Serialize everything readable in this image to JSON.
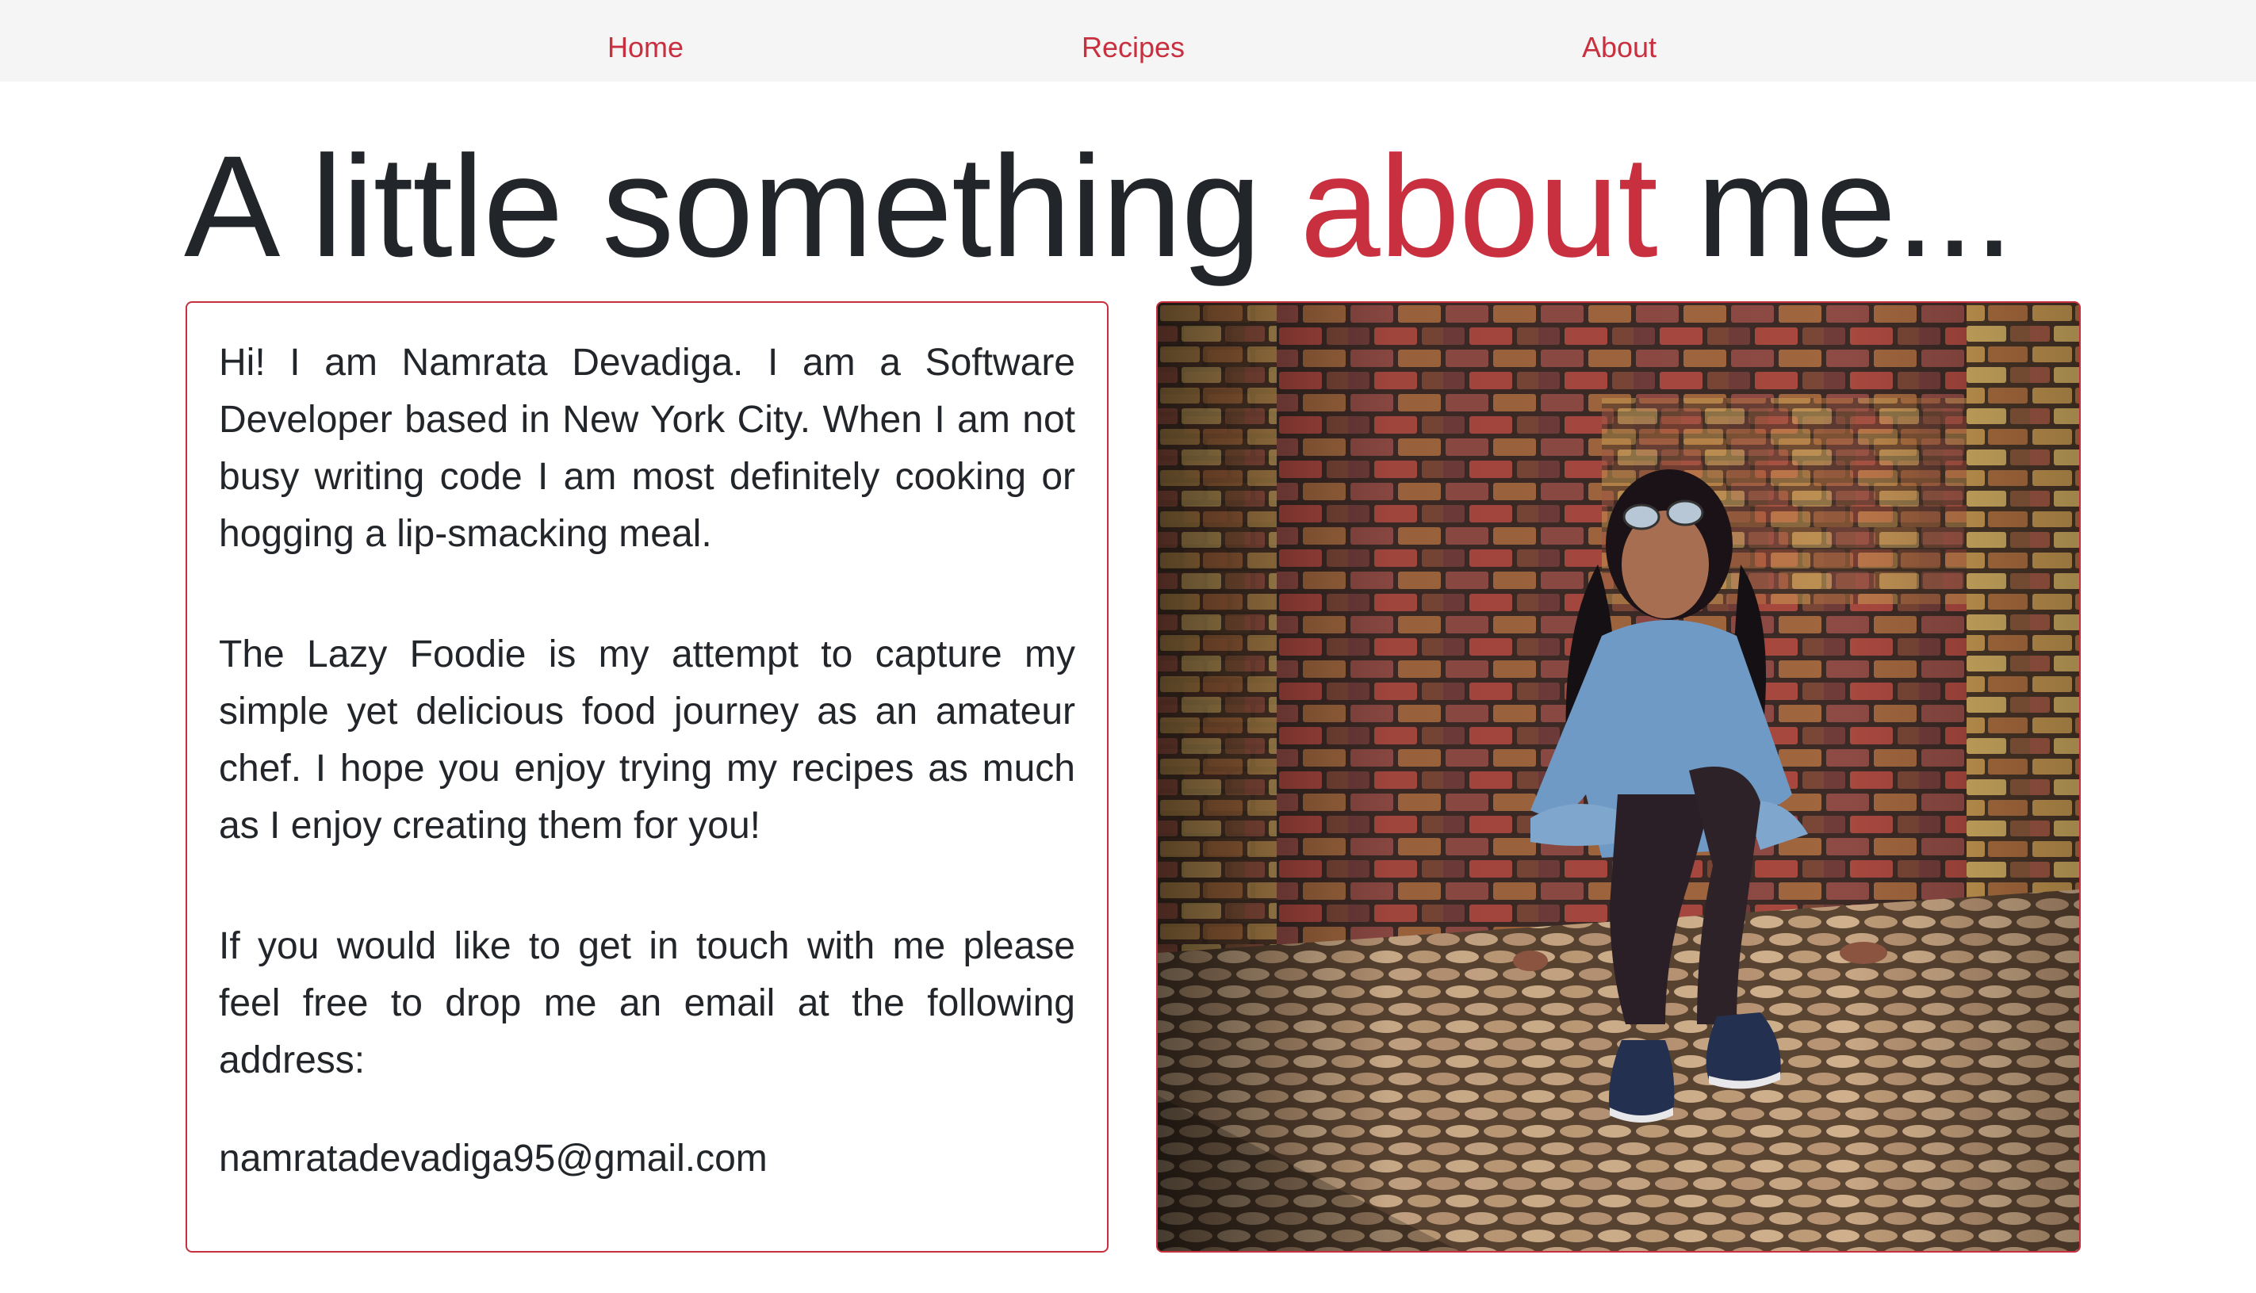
{
  "nav": {
    "home": "Home",
    "recipes": "Recipes",
    "about": "About"
  },
  "heading": {
    "before": "A little something ",
    "accent": "about",
    "after": " me..."
  },
  "bio": {
    "paragraph1": "Hi! I am Namrata Devadiga. I am a Software Developer based in New York City. When I am not busy writing code I am most definitely cooking or hogging a lip-smacking meal.",
    "paragraph2": "The Lazy Foodie is my attempt to capture my simple yet delicious food journey as an amateur chef. I hope you enjoy trying my recipes as much as I enjoy creating them for you!",
    "paragraph3": "If you would like to get in touch with me please feel free to drop me an email at the following address:",
    "email": "namratadevadiga95@gmail.com"
  },
  "colors": {
    "accent": "#c9303f",
    "text": "#222529",
    "navbar_bg": "#f5f5f5"
  }
}
